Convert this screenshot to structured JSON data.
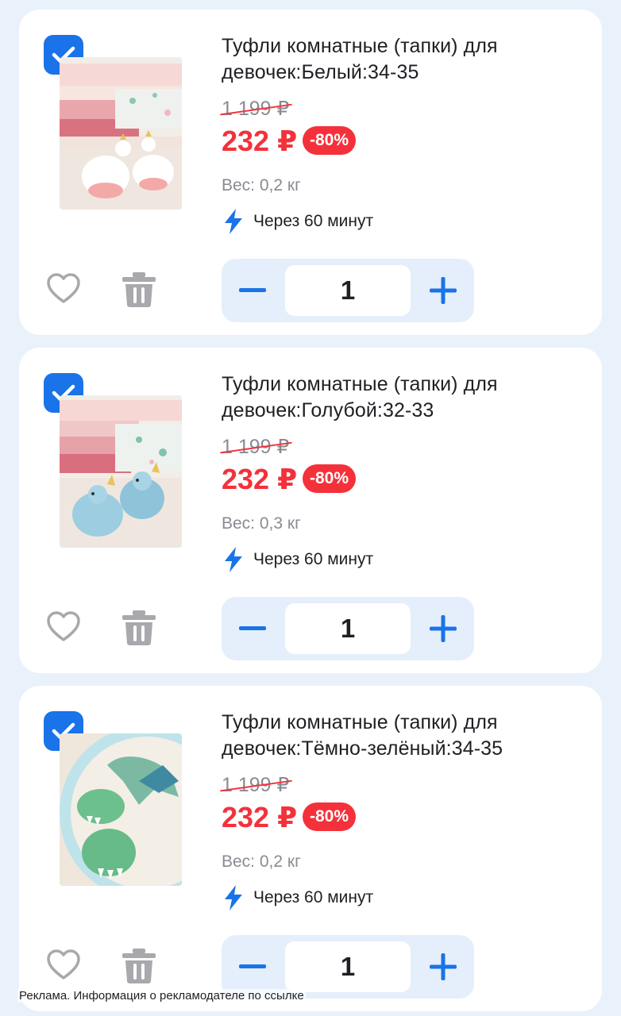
{
  "colors": {
    "accent": "#1a73e8",
    "price_red": "#f4313b",
    "stepper_bg": "#e5effb",
    "background": "#e9f1fb"
  },
  "items": [
    {
      "selected": true,
      "title_line1": "Туфли комнатные (тапки) для",
      "title_line2": "девочек:Белый:34-35",
      "old_price": "1 199 ₽",
      "price": "232 ₽",
      "discount": "-80%",
      "weight": "Вес: 0,2 кг",
      "delivery": "Через 60 минут",
      "quantity": "1",
      "image": "white-unicorn-slippers"
    },
    {
      "selected": true,
      "title_line1": "Туфли комнатные (тапки) для",
      "title_line2": "девочек:Голубой:32-33",
      "old_price": "1 199 ₽",
      "price": "232 ₽",
      "discount": "-80%",
      "weight": "Вес: 0,3 кг",
      "delivery": "Через 60 минут",
      "quantity": "1",
      "image": "blue-dragon-slippers"
    },
    {
      "selected": true,
      "title_line1": "Туфли комнатные (тапки) для",
      "title_line2": "девочек:Тёмно-зелёный:34-35",
      "old_price": "1 199 ₽",
      "price": "232 ₽",
      "discount": "-80%",
      "weight": "Вес: 0,2 кг",
      "delivery": "Через 60 минут",
      "quantity": "1",
      "image": "green-dinosaur-slippers"
    }
  ],
  "icons": {
    "checkbox": "check-icon",
    "delivery": "lightning-icon",
    "favorite": "heart-icon",
    "delete": "trash-icon",
    "decrease": "minus-icon",
    "increase": "plus-icon"
  },
  "ad_notice": "Реклама. Информация о рекламодателе по ссылке"
}
